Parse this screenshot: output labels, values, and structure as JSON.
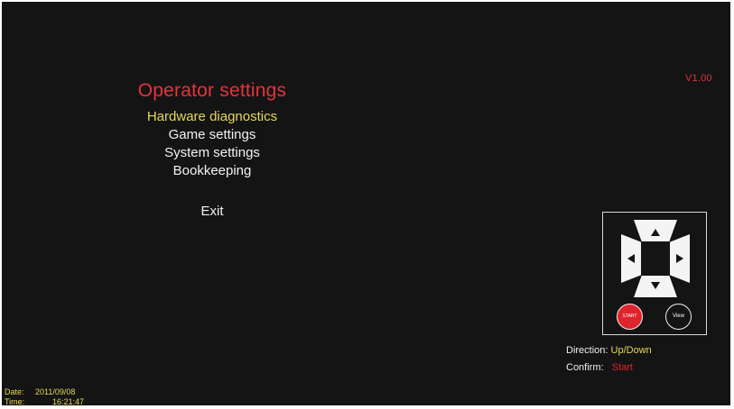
{
  "version": "V1.00",
  "menu": {
    "title": "Operator settings",
    "items": [
      {
        "label": "Hardware diagnostics"
      },
      {
        "label": "Game settings"
      },
      {
        "label": "System settings"
      },
      {
        "label": "Bookkeeping"
      }
    ],
    "exit": "Exit"
  },
  "controls": {
    "start_label": "START",
    "view_label": "View"
  },
  "help": {
    "direction_label": "Direction:",
    "direction_value": "Up/Down",
    "confirm_label": "Confirm:",
    "confirm_value": "Start"
  },
  "status": {
    "date_label": "Date:",
    "date_value": "2011/09/08",
    "time_label": "Time:",
    "time_value": "16:21:47"
  },
  "colors": {
    "background": "#141414",
    "title": "#e8323a",
    "selected": "#e6d85a",
    "text": "#f2f2f2",
    "start_button": "#e0242c"
  }
}
